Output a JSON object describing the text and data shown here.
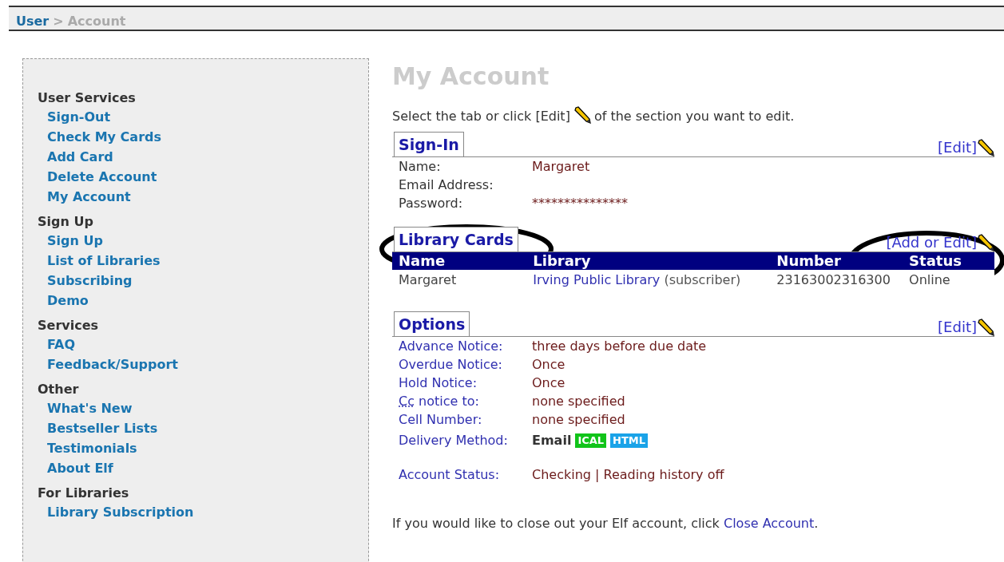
{
  "breadcrumb": {
    "parent": "User",
    "separator": ">",
    "current": "Account"
  },
  "sidebar": {
    "sections": [
      {
        "title": "User Services",
        "items": [
          "Sign-Out",
          "Check My Cards",
          "Add Card",
          "Delete Account",
          "My Account"
        ]
      },
      {
        "title": "Sign Up",
        "items": [
          "Sign Up",
          "List of Libraries",
          "Subscribing",
          "Demo"
        ]
      },
      {
        "title": "Services",
        "items": [
          "FAQ",
          "Feedback/Support"
        ]
      },
      {
        "title": "Other",
        "items": [
          "What's New",
          "Bestseller Lists",
          "Testimonials",
          "About Elf"
        ]
      },
      {
        "title": "For Libraries",
        "items": [
          "Library Subscription"
        ]
      }
    ]
  },
  "page_title": "My Account",
  "intro": {
    "before": "Select the tab or click [Edit]",
    "after": "of the section you want to edit."
  },
  "sign_in": {
    "tab": "Sign-In",
    "edit_link": "[Edit]",
    "fields": [
      {
        "label": "Name:",
        "value": "Margaret"
      },
      {
        "label": "Email Address:"
      },
      {
        "label": "Password:",
        "value": "***************"
      }
    ]
  },
  "library_cards": {
    "tab": "Library Cards",
    "edit_link": "[Add or Edit]",
    "table": {
      "columns": [
        "Name",
        "Library",
        "Number",
        "Status"
      ],
      "rows": [
        {
          "name": "Margaret",
          "library": "Irving Public Library",
          "library_note": "(subscriber)",
          "number": "23163002316300",
          "status": "Online"
        }
      ]
    }
  },
  "options": {
    "tab": "Options",
    "edit_link": "[Edit]",
    "fields": [
      {
        "label": "Advance Notice:",
        "value": "three days before due date"
      },
      {
        "label": "Overdue Notice:",
        "value": "Once"
      },
      {
        "label": "Hold Notice:",
        "value": "Once"
      },
      {
        "kind": "abbr",
        "abbr": "Cc",
        "label": "notice to:",
        "value": "none specified"
      },
      {
        "label": "Cell Number:",
        "value": "none specified"
      }
    ],
    "delivery": {
      "label": "Delivery Method:",
      "method": "Email",
      "badges": [
        {
          "label": "ICAL",
          "color": "#11c41a"
        },
        {
          "label": "HTML",
          "color": "#1aa3e8"
        }
      ]
    },
    "account_status": {
      "label": "Account Status:",
      "value": "Checking | Reading history off"
    }
  },
  "footer": {
    "text": "If you would like to close out your Elf account, click",
    "link": "Close Account",
    "end": "."
  }
}
